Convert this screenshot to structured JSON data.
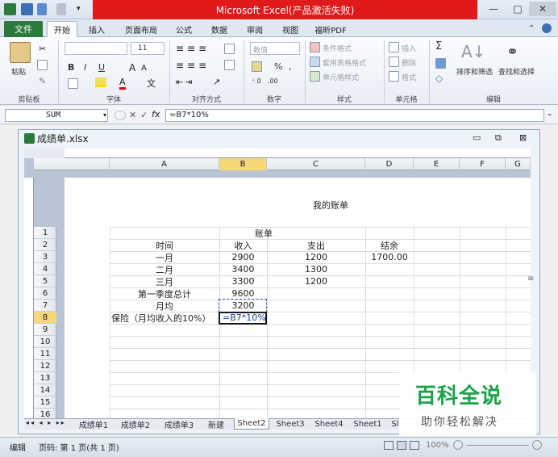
{
  "window": {
    "title": "Microsoft Excel(产品激活失败)",
    "min": "—",
    "max": "□",
    "close": "✕"
  },
  "ribbon_tabs": [
    "文件",
    "开始",
    "插入",
    "页面布局",
    "公式",
    "数据",
    "审阅",
    "视图",
    "福昕PDF"
  ],
  "ribbon": {
    "groups": [
      "剪贴板",
      "字体",
      "对齐方式",
      "数字",
      "样式",
      "单元格",
      "编辑"
    ],
    "paste": "粘贴",
    "font_size": "11",
    "number_format": "数值",
    "conditional_format": "条件格式",
    "table_format": "套用表格格式",
    "cell_style": "单元格样式",
    "insert": "插入",
    "delete": "删除",
    "format": "格式",
    "sort_filter": "排序和筛选",
    "find_select": "查找和选择",
    "percent": "%",
    "comma": ",",
    "bold": "B",
    "italic": "I",
    "underline": "U",
    "sigma": "Σ"
  },
  "formula_bar": {
    "name_box": "SUM",
    "formula": "=B7*10%",
    "cancel": "✕",
    "enter": "✓",
    "fx": "fx"
  },
  "workbook": {
    "filename": "成绩单.xlsx",
    "page_header": "我的账单",
    "columns": [
      "A",
      "B",
      "C",
      "D",
      "E",
      "F",
      "G"
    ],
    "rows": [
      "1",
      "2",
      "3",
      "4",
      "5",
      "6",
      "7",
      "8",
      "9",
      "10",
      "11",
      "12",
      "13",
      "14",
      "15",
      "16"
    ],
    "cells": {
      "r1": {
        "A": "账单"
      },
      "r2": {
        "A": "时间",
        "B": "收入",
        "C": "支出",
        "D": "结余"
      },
      "r3": {
        "A": "一月",
        "B": "2900",
        "C": "1200",
        "D": "1700.00"
      },
      "r4": {
        "A": "二月",
        "B": "3400",
        "C": "1300"
      },
      "r5": {
        "A": "三月",
        "B": "3300",
        "C": "1200"
      },
      "r6": {
        "A": "第一季度总计",
        "B": "9600"
      },
      "r7": {
        "A": "月均",
        "B": "3200"
      },
      "r8": {
        "A": "保险（月均收入的10%）",
        "B": "=B7*10%"
      }
    },
    "sheets": [
      "成绩单1",
      "成绩单2",
      "成绩单3",
      "新建",
      "Sheet2",
      "Sheet3",
      "Sheet4",
      "Sheet1",
      "Sl"
    ],
    "active_sheet": "Sheet2"
  },
  "status": {
    "mode": "编辑",
    "page": "页码: 第 1 页(共 1 页)",
    "zoom": "100%"
  },
  "watermark": {
    "title": "百科全说",
    "subtitle": "助你轻松解决"
  },
  "colors": {
    "excel_green": "#2a7a3b",
    "title_red": "#e0191b",
    "selection": "#f8d779",
    "watermark_green": "#1aa34a"
  }
}
